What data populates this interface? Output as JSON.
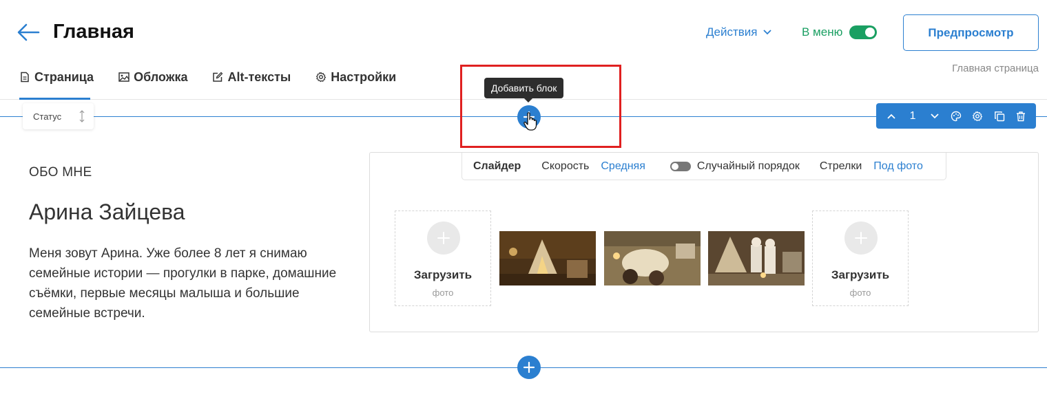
{
  "header": {
    "title": "Главная",
    "actions_label": "Действия",
    "in_menu_label": "В меню",
    "preview_label": "Предпросмотр",
    "breadcrumb": "Главная страница"
  },
  "tabs": [
    {
      "label": "Страница",
      "icon": "document-icon",
      "active": true
    },
    {
      "label": "Обложка",
      "icon": "image-icon"
    },
    {
      "label": "Alt-тексты",
      "icon": "edit-icon"
    },
    {
      "label": "Настройки",
      "icon": "gear-icon"
    }
  ],
  "block": {
    "status_label": "Статус",
    "tooltip": "Добавить блок",
    "toolbar_index": "1"
  },
  "content": {
    "section_label": "ОБО МНЕ",
    "name": "Арина Зайцева",
    "bio": "Меня зовут Арина. Уже более 8 лет я снимаю семейные истории — прогулки в парке, домашние съёмки, первые месяцы малыша и большие семейные встречи."
  },
  "slider": {
    "title": "Слайдер",
    "speed_label": "Скорость",
    "speed_value": "Средняя",
    "random_label": "Случайный порядок",
    "random_enabled": false,
    "arrows_label": "Стрелки",
    "arrows_value": "Под фото",
    "upload_title": "Загрузить",
    "upload_sub": "фото",
    "photos": [
      "teepee-tent-photo",
      "family-on-floor-photo",
      "children-playing-photo"
    ]
  },
  "colors": {
    "accent": "#2b7fd0",
    "menu_green": "#1a9f62",
    "highlight_red": "#e02020"
  }
}
